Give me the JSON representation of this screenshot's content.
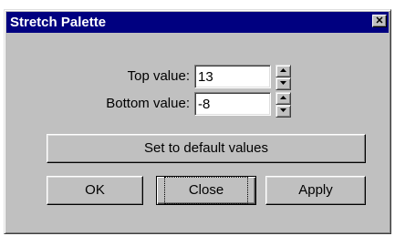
{
  "window": {
    "title": "Stretch Palette",
    "close_glyph": "✕"
  },
  "top_value": {
    "label": "Top value:",
    "value": "13"
  },
  "bottom_value": {
    "label": "Bottom value:",
    "value": "-8"
  },
  "buttons": {
    "set_default": "Set to default values",
    "ok": "OK",
    "close": "Close",
    "apply": "Apply"
  },
  "icons": {
    "spin_up": "triangle-up-icon",
    "spin_down": "triangle-down-icon",
    "close": "close-icon"
  },
  "colors": {
    "titlebar": "#000080",
    "face": "#c0c0c0",
    "field": "#ffffff"
  }
}
